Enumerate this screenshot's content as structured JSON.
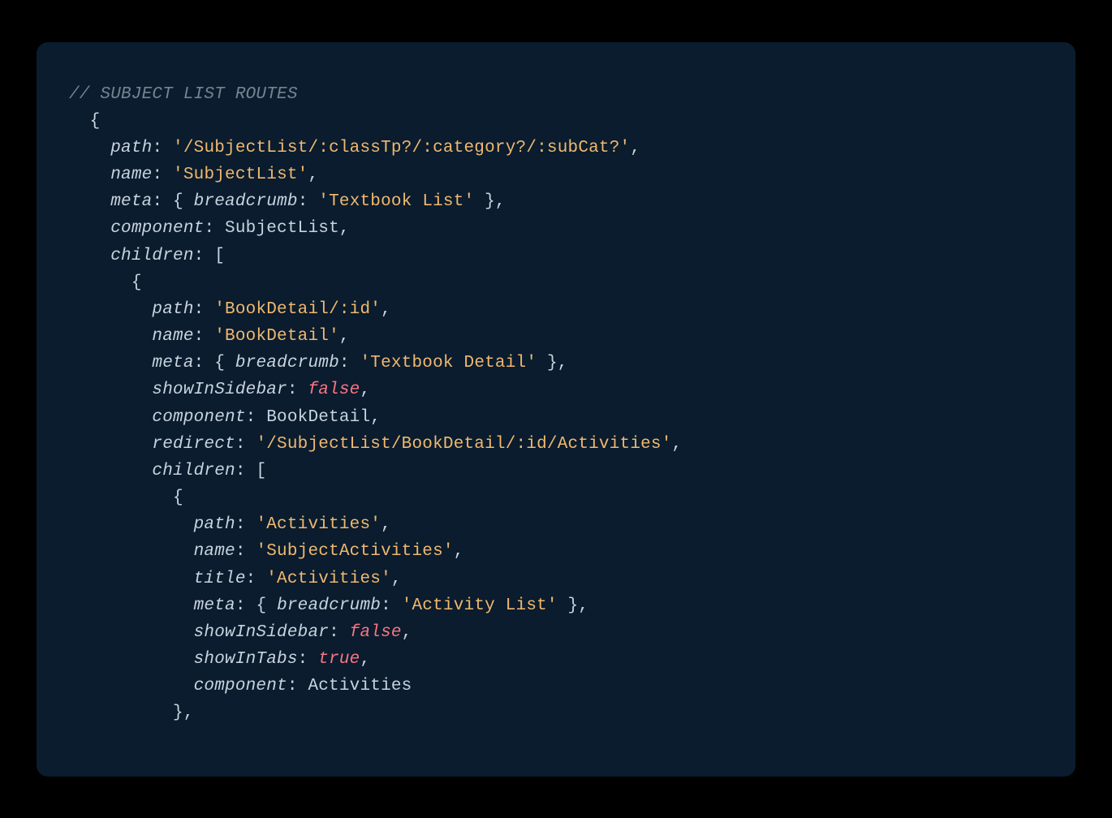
{
  "code": {
    "comment": "// SUBJECT LIST ROUTES",
    "route": {
      "open_brace": "{",
      "path_key": "path",
      "path_val": "'/SubjectList/:classTp?/:category?/:subCat?'",
      "name_key": "name",
      "name_val": "'SubjectList'",
      "meta_key": "meta",
      "meta_open": "{ ",
      "breadcrumb_key": "breadcrumb",
      "meta_val": "'Textbook List'",
      "meta_close": " }",
      "component_key": "component",
      "component_val": "SubjectList",
      "children_key": "children",
      "children_open": "[",
      "child1": {
        "open": "{",
        "path_key": "path",
        "path_val": "'BookDetail/:id'",
        "name_key": "name",
        "name_val": "'BookDetail'",
        "meta_key": "meta",
        "breadcrumb_key": "breadcrumb",
        "meta_val": "'Textbook Detail'",
        "showInSidebar_key": "showInSidebar",
        "showInSidebar_val": "false",
        "component_key": "component",
        "component_val": "BookDetail",
        "redirect_key": "redirect",
        "redirect_val": "'/SubjectList/BookDetail/:id/Activities'",
        "children_key": "children",
        "children_open": "[",
        "gc1": {
          "open": "{",
          "path_key": "path",
          "path_val": "'Activities'",
          "name_key": "name",
          "name_val": "'SubjectActivities'",
          "title_key": "title",
          "title_val": "'Activities'",
          "meta_key": "meta",
          "breadcrumb_key": "breadcrumb",
          "meta_val": "'Activity List'",
          "showInSidebar_key": "showInSidebar",
          "showInSidebar_val": "false",
          "showInTabs_key": "showInTabs",
          "showInTabs_val": "true",
          "component_key": "component",
          "component_val": "Activities",
          "close": "},"
        }
      }
    }
  }
}
